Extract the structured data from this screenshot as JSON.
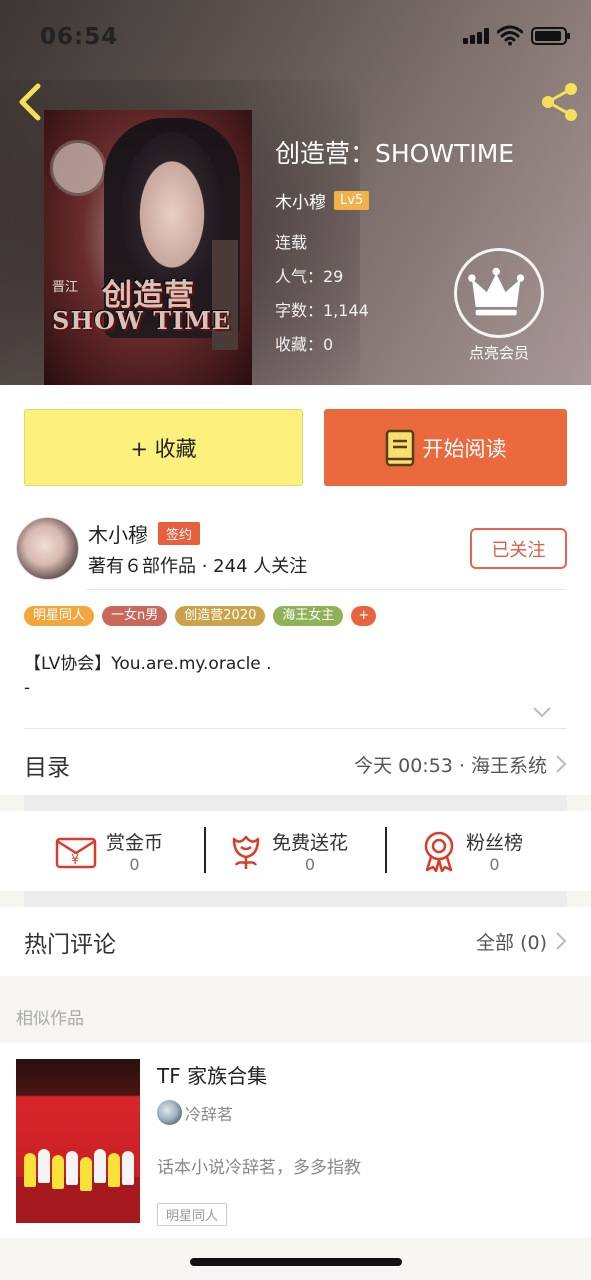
{
  "status_bar": {
    "time": "06:54"
  },
  "book": {
    "title": "创造营：SHOWTIME",
    "author": "木小穆",
    "author_level": "Lv5",
    "status": "连载",
    "popularity": "人气：29",
    "word_count": "字数：1,144",
    "favorites": "收藏：0",
    "cover_title_line1": "创造营",
    "cover_title_line2": "SHOW TIME",
    "cover_corner_text": "晋江"
  },
  "vip": {
    "label": "点亮会员"
  },
  "actions": {
    "favorite_label": "+ 收藏",
    "read_label": "开始阅读"
  },
  "author_card": {
    "name": "木小穆",
    "badge": "签约",
    "stats": "著有６部作品 · 244 人关注",
    "follow_label": "已关注"
  },
  "tags": [
    {
      "label": "明星同人",
      "color": "#f1a73d"
    },
    {
      "label": "一女n男",
      "color": "#c7685b"
    },
    {
      "label": "创造营2020",
      "color": "#c9a24b"
    },
    {
      "label": "海王女主",
      "color": "#8fb158"
    },
    {
      "label": "+",
      "color": "#e8633f"
    }
  ],
  "intro": {
    "line1": "【LV协会】You.are.my.oracle .",
    "line2": "-"
  },
  "toc": {
    "label": "目录",
    "latest": "今天 00:53 · 海王系统"
  },
  "stats": [
    {
      "name": "赏金币",
      "value": "0",
      "icon": "coin-envelope-icon"
    },
    {
      "name": "免费送花",
      "value": "0",
      "icon": "flower-icon"
    },
    {
      "name": "粉丝榜",
      "value": "0",
      "icon": "ribbon-badge-icon"
    }
  ],
  "comments": {
    "label": "热门评论",
    "all_label": "全部 (0)"
  },
  "similar": {
    "section_label": "相似作品",
    "title": "TF 家族合集",
    "author": "冷辞茗",
    "desc": "话本小说冷辞茗，多多指教",
    "tag": "明星同人"
  },
  "colors": {
    "accent_orange": "#ea6a3d",
    "favorite_yellow": "#fdf07d",
    "nav_icon_yellow": "#f3e15a",
    "sign_red": "#e75f3d"
  }
}
